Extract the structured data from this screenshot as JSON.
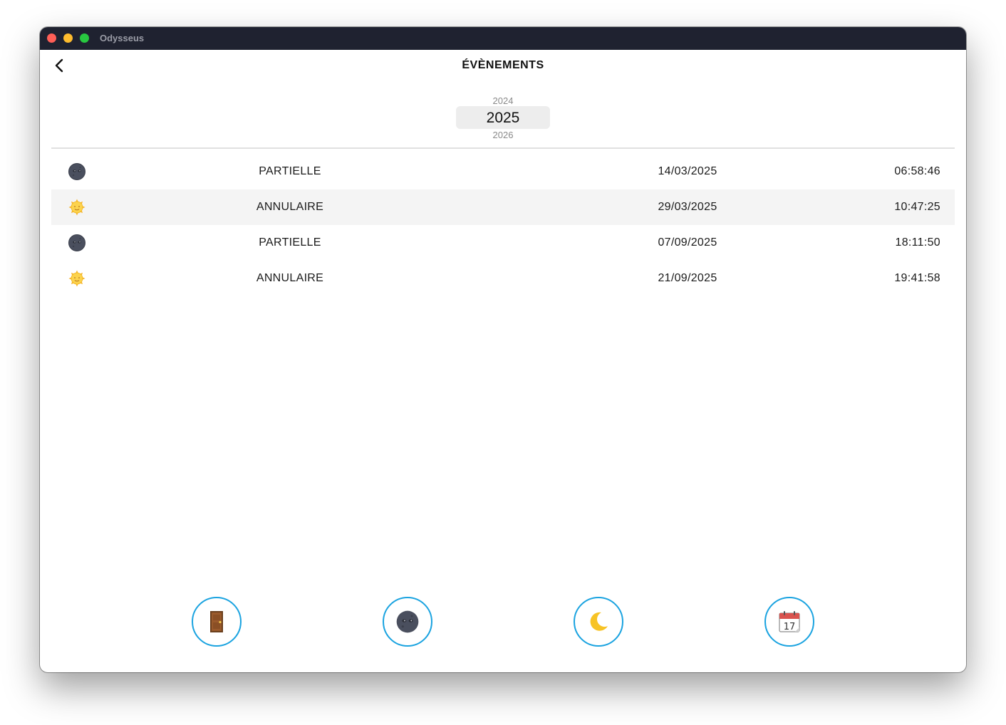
{
  "window": {
    "title": "Odysseus"
  },
  "header": {
    "title": "ÉVÈNEMENTS",
    "back_icon": "chevron-left-icon"
  },
  "year_picker": {
    "previous": "2024",
    "selected": "2025",
    "next": "2026"
  },
  "events": [
    {
      "icon": "new-moon-face-icon",
      "type": "PARTIELLE",
      "date": "14/03/2025",
      "time": "06:58:46"
    },
    {
      "icon": "sun-face-icon",
      "type": "ANNULAIRE",
      "date": "29/03/2025",
      "time": "10:47:25"
    },
    {
      "icon": "new-moon-face-icon",
      "type": "PARTIELLE",
      "date": "07/09/2025",
      "time": "18:11:50"
    },
    {
      "icon": "sun-face-icon",
      "type": "ANNULAIRE",
      "date": "21/09/2025",
      "time": "19:41:58"
    }
  ],
  "bottom_nav": [
    {
      "icon": "door-icon"
    },
    {
      "icon": "new-moon-face-icon"
    },
    {
      "icon": "crescent-moon-icon"
    },
    {
      "icon": "calendar-icon"
    }
  ],
  "colors": {
    "titlebar": "#1f2230",
    "nav_border": "#1aa3e0",
    "row_alt": "#f4f4f4",
    "selected_year_bg": "#ededed"
  }
}
